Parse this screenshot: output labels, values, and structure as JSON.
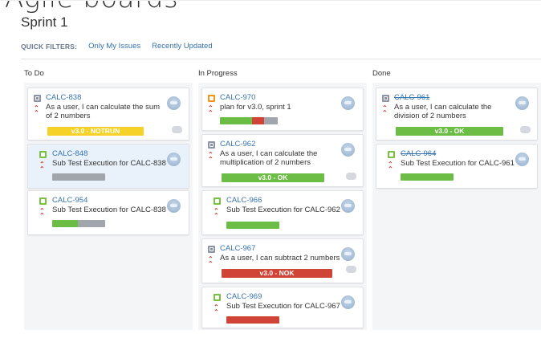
{
  "page": {
    "heading": "Agile boards"
  },
  "board": {
    "sprint_title": "Sprint 1",
    "filters": {
      "label": "QUICK FILTERS:",
      "items": [
        "Only My Issues",
        "Recently Updated"
      ]
    },
    "columns": [
      {
        "name": "To Do"
      },
      {
        "name": "In Progress"
      },
      {
        "name": "Done"
      }
    ]
  },
  "cards": {
    "calc838": {
      "key": "CALC-838",
      "summary1": "As a user, I can calculate the sum",
      "summary2": "of 2 numbers",
      "status": "v3.0 - NOTRUN",
      "type": "story"
    },
    "calc848": {
      "key": "CALC-848",
      "summary1": "Sub Test Execution for CALC-838",
      "type": "test"
    },
    "calc954": {
      "key": "CALC-954",
      "summary1": "Sub Test Execution for CALC-838",
      "type": "test"
    },
    "calc970": {
      "key": "CALC-970",
      "summary1": "plan for v3.0, sprint 1",
      "type": "plan"
    },
    "calc962": {
      "key": "CALC-962",
      "summary1": "As a user, I can calculate the",
      "summary2": "multiplication of 2 numbers",
      "status": "v3.0 - OK",
      "type": "story"
    },
    "calc966": {
      "key": "CALC-966",
      "summary1": "Sub Test Execution for CALC-962",
      "type": "test"
    },
    "calc967": {
      "key": "CALC-967",
      "summary1": "As a user, I can subtract 2 numbers",
      "status": "v3.0 - NOK",
      "type": "story"
    },
    "calc969": {
      "key": "CALC-969",
      "summary1": "Sub Test Execution for CALC-967",
      "type": "test"
    },
    "calc961": {
      "key": "CALC-961",
      "summary1": "As a user, I can calculate the",
      "summary2": "division of 2 numbers",
      "status": "v3.0 - OK",
      "type": "story"
    },
    "calc964": {
      "key": "CALC-964",
      "summary1": "Sub Test Execution for CALC-961",
      "type": "test"
    }
  },
  "colors": {
    "pass": "#6cbd45",
    "fail": "#d04437",
    "notrun": "#a1a6ad",
    "todo_yellow": "#f6d128",
    "link": "#3572b0"
  },
  "icons": [
    "avatar-icon",
    "priority-highest-icon",
    "story-icon",
    "test-icon",
    "test-plan-icon",
    "more-dots-icon"
  ]
}
